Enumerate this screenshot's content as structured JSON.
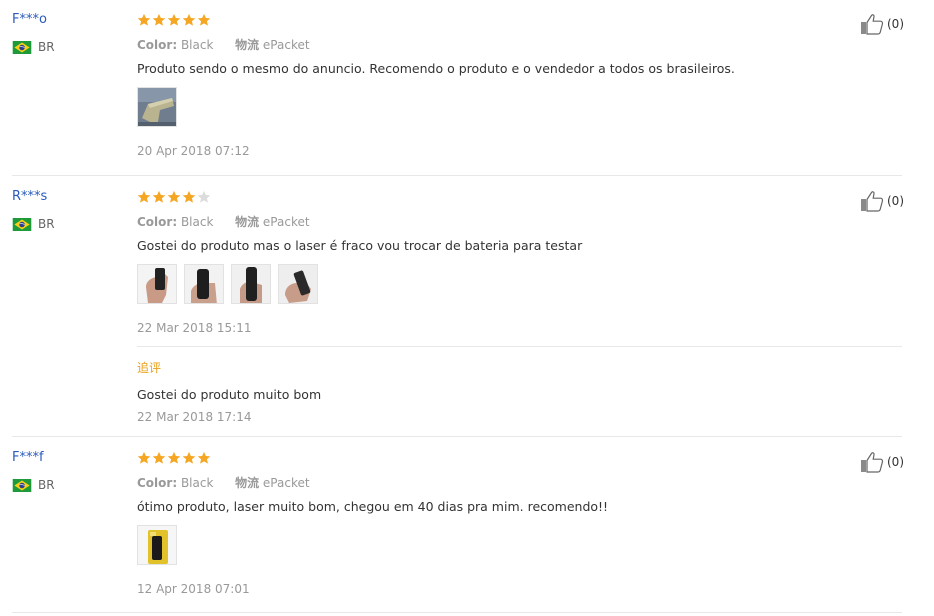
{
  "reviews": [
    {
      "user": "F***o",
      "country": "BR",
      "rating": 5,
      "color_label": "Color:",
      "color_value": "Black",
      "shipping_label": "物流",
      "shipping_value": "ePacket",
      "text": "Produto sendo o mesmo do anuncio. Recomendo o produto e o vendedor a todos os brasileiros.",
      "date": "20 Apr 2018 07:12",
      "helpful": "(0)"
    },
    {
      "user": "R***s",
      "country": "BR",
      "rating": 4,
      "color_label": "Color:",
      "color_value": "Black",
      "shipping_label": "物流",
      "shipping_value": "ePacket",
      "text": "Gostei do produto mas o laser é fraco vou trocar de bateria para testar",
      "date": "22 Mar 2018 15:11",
      "helpful": "(0)",
      "followup": {
        "label": "追评",
        "text": "Gostei do produto muito bom",
        "date": "22 Mar 2018 17:14"
      }
    },
    {
      "user": "F***f",
      "country": "BR",
      "rating": 5,
      "color_label": "Color:",
      "color_value": "Black",
      "shipping_label": "物流",
      "shipping_value": "ePacket",
      "text": "ótimo produto, laser muito bom, chegou em 40 dias pra mim. recomendo!!",
      "date": "12 Apr 2018 07:01",
      "helpful": "(0)"
    }
  ],
  "colors": {
    "star_filled": "#f5a623",
    "star_empty": "#dcdcdc",
    "user_link": "#2a5bbd",
    "followup_label": "#e8a01a"
  },
  "icons": {
    "flag": "brazil-flag-icon",
    "helpful": "thumbs-up-icon",
    "star": "star-icon"
  }
}
